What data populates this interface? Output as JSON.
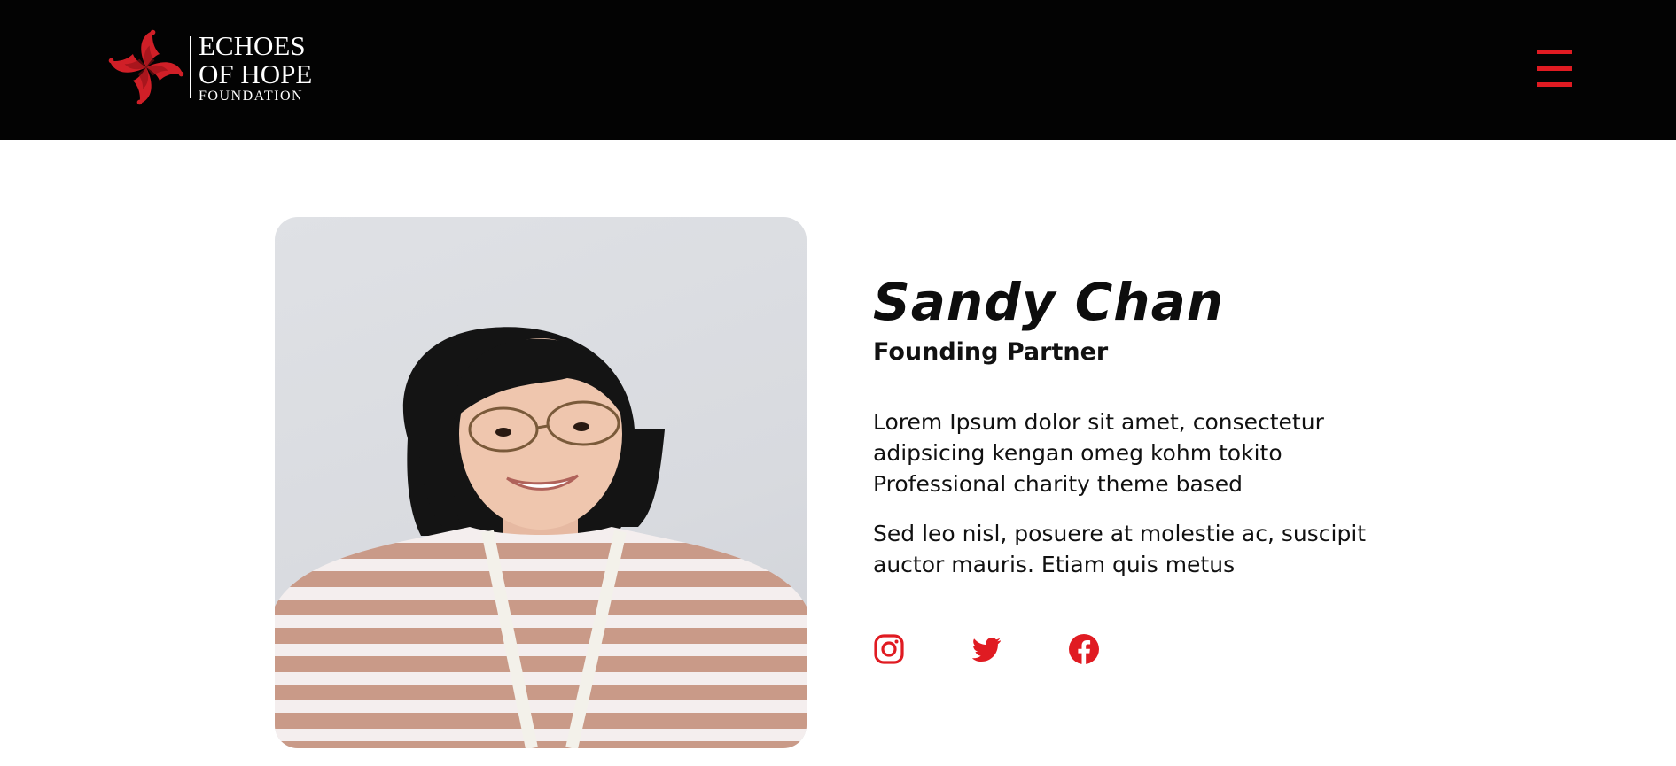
{
  "header": {
    "logo": {
      "line1": "ECHOES",
      "line2": "OF HOPE",
      "line3": "FOUNDATION"
    },
    "menu_icon": "hamburger-menu-icon"
  },
  "profile": {
    "name": "Sandy Chan",
    "role": "Founding Partner",
    "bio": [
      "Lorem Ipsum dolor sit amet, consectetur adipsicing kengan omeg kohm tokito Professional charity theme based",
      "Sed leo nisl, posuere at molestie ac, suscipit auctor mauris. Etiam quis metus"
    ],
    "photo_subject": "portrait of a smiling woman with glasses in a striped shirt",
    "social": [
      {
        "icon": "instagram-icon"
      },
      {
        "icon": "twitter-icon"
      },
      {
        "icon": "facebook-icon"
      }
    ]
  },
  "colors": {
    "header_bg": "#030303",
    "accent": "#e01b22",
    "page_bg": "#ffffff",
    "text": "#111111"
  }
}
